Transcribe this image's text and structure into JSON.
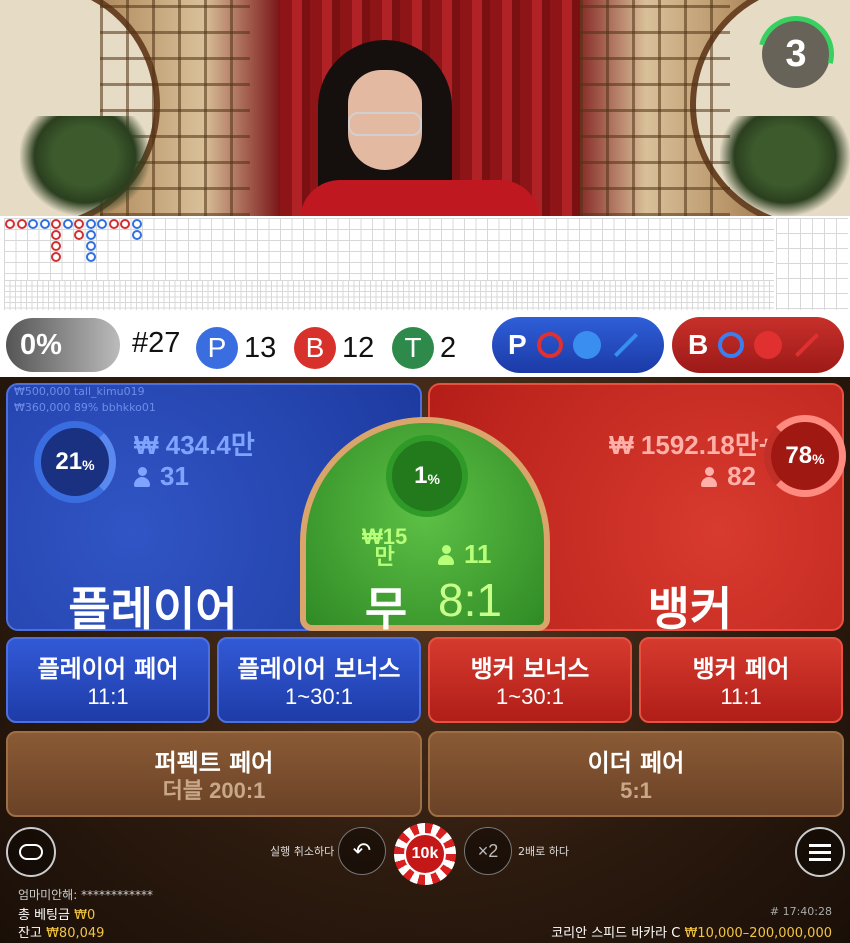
{
  "timer": {
    "value": "3"
  },
  "stats": {
    "percent": "0%",
    "round": "#27",
    "player_letter": "P",
    "player_count": "13",
    "banker_letter": "B",
    "banker_count": "12",
    "tie_letter": "T",
    "tie_count": "2"
  },
  "predict": {
    "player_letter": "P",
    "banker_letter": "B"
  },
  "bets": {
    "player": {
      "label": "플레이어",
      "percent": "21",
      "amount": "₩ 434.4만",
      "players": "31",
      "ticker1": "₩500,000  tall_kimu019",
      "ticker2": "₩360,000  89% bbhkko01"
    },
    "tie": {
      "label": "무",
      "odds": "8:1",
      "percent": "1",
      "amount_line1": "₩15",
      "amount_line2": "만",
      "players": "11"
    },
    "banker": {
      "label": "뱅커",
      "percent": "78",
      "amount": "₩ 1592.18만+",
      "players": "82"
    }
  },
  "side_bets": [
    {
      "label": "플레이어 페어",
      "odds": "11:1"
    },
    {
      "label": "플레이어 보너스",
      "odds": "1~30:1"
    },
    {
      "label": "뱅커 보너스",
      "odds": "1~30:1"
    },
    {
      "label": "뱅커 페어",
      "odds": "11:1"
    }
  ],
  "extra_bets": [
    {
      "label": "퍼펙트 페어",
      "odds": "더블 200:1"
    },
    {
      "label": "이더 페어",
      "odds": "5:1"
    }
  ],
  "controls": {
    "undo_label": "실행 취소하다",
    "chip_value": "10k",
    "double_symbol": "×2",
    "double_label": "2배로 하다"
  },
  "footer": {
    "username": "엄마미안해: ************",
    "total_bet_label": "총 베팅금",
    "total_bet": "₩0",
    "balance_label": "잔고",
    "balance": "₩80,049",
    "time": "# 17:40:28",
    "table_name": "코리안 스피드 바카라 C",
    "limits": "₩10,000–200,000,000"
  },
  "colors": {
    "player": "#2d5bd6",
    "banker": "#d6322a",
    "tie": "#3a9a3a",
    "gold": "#f2c440"
  },
  "icons": [
    "chat-icon",
    "undo-icon",
    "menu-icon",
    "chevron-up-icon",
    "person-icon"
  ]
}
